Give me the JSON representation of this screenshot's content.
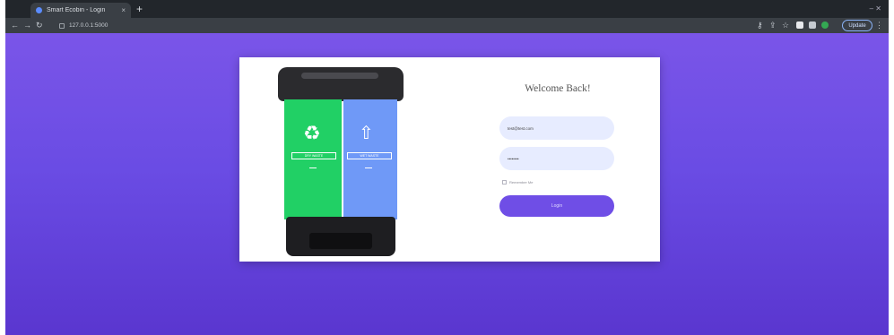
{
  "browser": {
    "tab_title": "Smart Ecobin - Login",
    "tab_close": "×",
    "new_tab": "+",
    "url": "127.0.0.1:5000",
    "update_label": "Update",
    "window_controls": "– ✕"
  },
  "bin_art": {
    "left_label": "DRY WASTE",
    "right_label": "WET WASTE",
    "left_color": "#21d065",
    "right_color": "#6f99f7"
  },
  "login": {
    "title": "Welcome Back!",
    "email_value": "test@test.com",
    "password_value": "••••••••",
    "remember_label": "Remember Me",
    "button_label": "Login"
  },
  "colors": {
    "accent": "#6f4ee6",
    "background_top": "#7a55e8",
    "background_bottom": "#5a36cf"
  }
}
